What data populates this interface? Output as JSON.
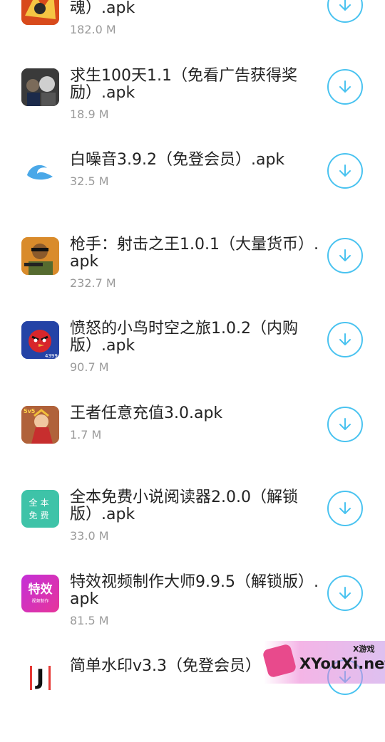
{
  "apps": [
    {
      "title": "魂）.apk",
      "size": "182.0 M",
      "icon": "action-game-icon"
    },
    {
      "title": "求生100天1.1（免看广告获得奖励）.apk",
      "size": "18.9 M",
      "icon": "granny-horror-icon"
    },
    {
      "title": "白噪音3.9.2（免登会员）.apk",
      "size": "32.5 M",
      "icon": "wave-icon"
    },
    {
      "title": "枪手：射击之王1.0.1（大量货币）.apk",
      "size": "232.7 M",
      "icon": "gunman-icon"
    },
    {
      "title": "愤怒的小鸟时空之旅1.0.2（内购版）.apk",
      "size": "90.7 M",
      "icon": "angry-bird-icon"
    },
    {
      "title": "王者任意充值3.0.apk",
      "size": "1.7 M",
      "icon": "hero-5v5-icon"
    },
    {
      "title": "全本免费小说阅读器2.0.0（解锁版）.apk",
      "size": "33.0 M",
      "icon": "novel-reader-icon"
    },
    {
      "title": "特效视频制作大师9.9.5（解锁版）.apk",
      "size": "81.5 M",
      "icon": "video-effects-icon"
    },
    {
      "title": "简单水印v3.3（免登会员）",
      "size": "",
      "icon": "watermark-j-icon"
    }
  ],
  "icon_text": {
    "novel_line1": "全本",
    "novel_line2": "免费",
    "effects_main": "特效",
    "effects_sub": "视频制作",
    "hero_badge": "5v5",
    "bird_badge": "4399",
    "j_letter": "J"
  },
  "watermark": {
    "small": "X游戏",
    "big": "XYouXi.net"
  },
  "colors": {
    "accent": "#4ac3f0",
    "title": "#222222",
    "size": "#9a9a9a"
  }
}
